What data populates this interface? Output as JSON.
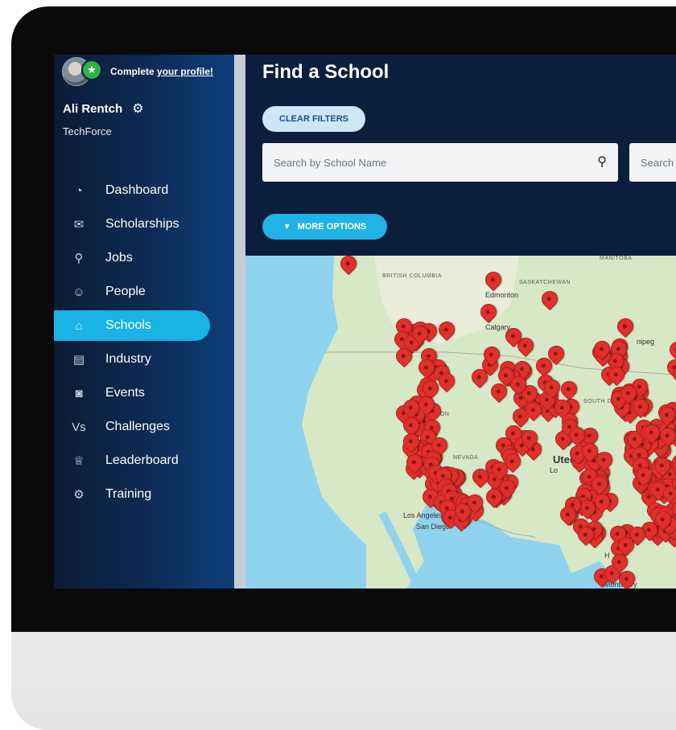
{
  "profile": {
    "prompt": "Complete",
    "link": "your profile!",
    "username": "Ali Rentch",
    "organization": "TechForce",
    "avatar_icon": "avatar",
    "badge_icon": "star-icon",
    "settings_icon": "gear-icon"
  },
  "sidebar": {
    "items": [
      {
        "label": "Dashboard",
        "icon": "dashboard-icon",
        "active": false
      },
      {
        "label": "Scholarships",
        "icon": "scholarships-icon",
        "active": false
      },
      {
        "label": "Jobs",
        "icon": "jobs-icon",
        "active": false
      },
      {
        "label": "People",
        "icon": "people-icon",
        "active": false
      },
      {
        "label": "Schools",
        "icon": "schools-icon",
        "active": true
      },
      {
        "label": "Industry",
        "icon": "industry-icon",
        "active": false
      },
      {
        "label": "Events",
        "icon": "events-icon",
        "active": false
      },
      {
        "label": "Challenges",
        "icon": "challenges-icon",
        "active": false
      },
      {
        "label": "Leaderboard",
        "icon": "leaderboard-icon",
        "active": false
      },
      {
        "label": "Training",
        "icon": "training-icon",
        "active": false
      }
    ]
  },
  "main": {
    "title": "Find a School",
    "clear_filters": "CLEAR FILTERS",
    "search_school_placeholder": "Search by School Name",
    "search_location_placeholder": "Search",
    "more_options": "MORE OPTIONS"
  },
  "map": {
    "labels": {
      "british_columbia": "BRITISH COLUMBIA",
      "saskatchewan": "SASKATCHEWAN",
      "manitoba": "MANITOBA",
      "edmonton": "Edmonton",
      "calgary": "Calgary",
      "winnipeg": "nipeg",
      "nevada": "NEVADA",
      "south_dakota": "SOUTH DAKOTA",
      "united": "Uted",
      "oregon": "GON",
      "los_angeles": "Los Angeles",
      "san_diego": "San Diego",
      "monterrey": "Monterrey",
      "colorado_fragment": "Lo",
      "houston_fragment": "H"
    }
  },
  "colors": {
    "sidebar_active": "#19b3e6",
    "header_bg": "#0b1e3e",
    "pin": "#e0302c",
    "ocean": "#8fd3ef"
  }
}
